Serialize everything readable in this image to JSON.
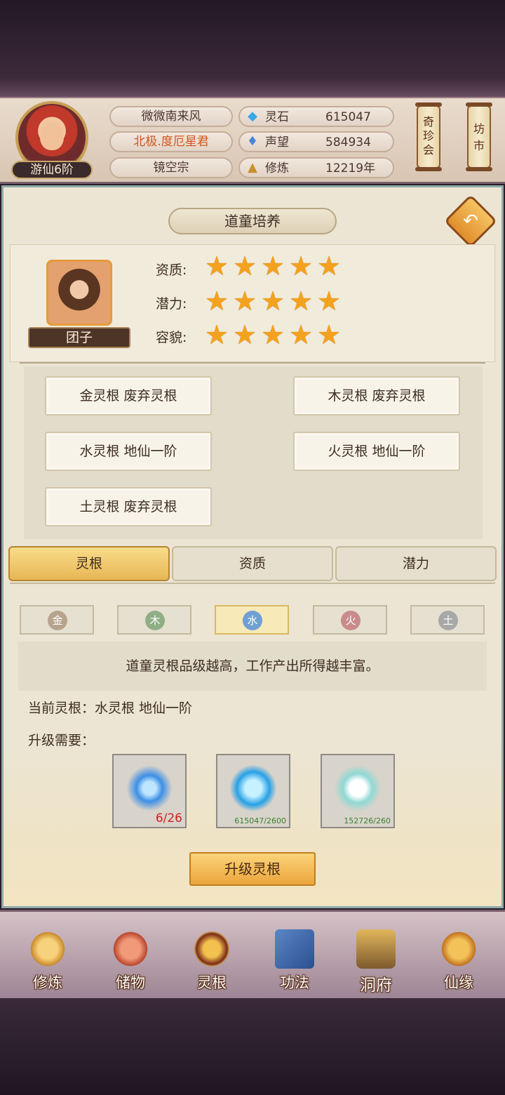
{
  "player": {
    "rank": "游仙6阶",
    "name": "微微南来风",
    "title": "北极.度厄星君",
    "sect": "镜空宗"
  },
  "resources": [
    {
      "icon": "spirit-stone-icon",
      "label": "灵石",
      "value": "615047"
    },
    {
      "icon": "prestige-icon",
      "label": "声望",
      "value": "584934"
    },
    {
      "icon": "cultivation-icon",
      "label": "修炼",
      "value": "12219年"
    }
  ],
  "side_buttons": {
    "treasure": "奇珍会",
    "market": "坊市"
  },
  "page": {
    "title": "道童培养"
  },
  "disciple": {
    "name": "团子",
    "attributes": [
      {
        "label": "资质:",
        "stars": 5
      },
      {
        "label": "潜力:",
        "stars": 5
      },
      {
        "label": "容貌:",
        "stars": 5
      }
    ]
  },
  "roots": [
    "金灵根 废弃灵根",
    "木灵根 废弃灵根",
    "水灵根 地仙一阶",
    "火灵根 地仙一阶",
    "土灵根 废弃灵根"
  ],
  "tabs": [
    "灵根",
    "资质",
    "潜力"
  ],
  "active_tab": "灵根",
  "elements": [
    {
      "label": "金",
      "color": "#b7a48c"
    },
    {
      "label": "木",
      "color": "#8fae86"
    },
    {
      "label": "水",
      "color": "#6f9fd4"
    },
    {
      "label": "火",
      "color": "#c98a8a"
    },
    {
      "label": "土",
      "color": "#a8a8a8"
    }
  ],
  "active_element": "水",
  "tip": "道童灵根品级越高，工作产出所得越丰富。",
  "current_root": "当前灵根：水灵根 地仙一阶",
  "requirement_label": "升级需要：",
  "materials": [
    {
      "icon": "spirit-essence-icon",
      "count": "6/26"
    },
    {
      "icon": "spirit-stone-icon",
      "count": "615047/2600"
    },
    {
      "icon": "elixir-gourd-icon",
      "count": "152726/260"
    }
  ],
  "upgrade_button": "升级灵根",
  "nav": [
    {
      "label": "修炼",
      "icon": "cultivate-icon"
    },
    {
      "label": "储物",
      "icon": "storage-bag-icon"
    },
    {
      "label": "灵根",
      "icon": "spirit-root-icon"
    },
    {
      "label": "功法",
      "icon": "technique-book-icon"
    },
    {
      "label": "洞府",
      "icon": "cave-dwelling-icon"
    },
    {
      "label": "仙缘",
      "icon": "fate-gourd-icon"
    }
  ],
  "colors": {
    "accent": "#e8b655",
    "title_highlight": "#d2551b",
    "panel": "#ece5d3"
  }
}
